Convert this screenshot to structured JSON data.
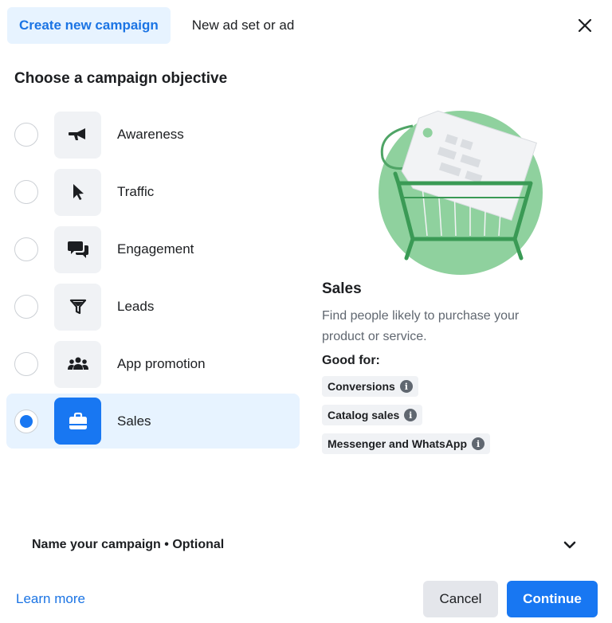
{
  "tabs": {
    "active_label": "Create new campaign",
    "inactive_label": "New ad set or ad"
  },
  "close_icon": "close-icon",
  "heading": "Choose a campaign objective",
  "objectives": [
    {
      "label": "Awareness",
      "icon": "megaphone-icon",
      "selected": false
    },
    {
      "label": "Traffic",
      "icon": "cursor-icon",
      "selected": false
    },
    {
      "label": "Engagement",
      "icon": "chat-bubbles-icon",
      "selected": false
    },
    {
      "label": "Leads",
      "icon": "funnel-icon",
      "selected": false
    },
    {
      "label": "App promotion",
      "icon": "people-icon",
      "selected": false
    },
    {
      "label": "Sales",
      "icon": "shopping-bag-icon",
      "selected": true
    }
  ],
  "detail": {
    "title": "Sales",
    "description": "Find people likely to purchase your product or service.",
    "good_for_label": "Good for:",
    "chips": [
      "Conversions",
      "Catalog sales",
      "Messenger and WhatsApp"
    ]
  },
  "name_campaign": {
    "label": "Name your campaign • Optional"
  },
  "footer": {
    "learn_more": "Learn more",
    "cancel": "Cancel",
    "continue": "Continue"
  },
  "colors": {
    "accent": "#1877f2",
    "accent_text": "#1b74e4",
    "selected_bg": "#e7f3ff",
    "illustration_green": "#8fd19e"
  }
}
